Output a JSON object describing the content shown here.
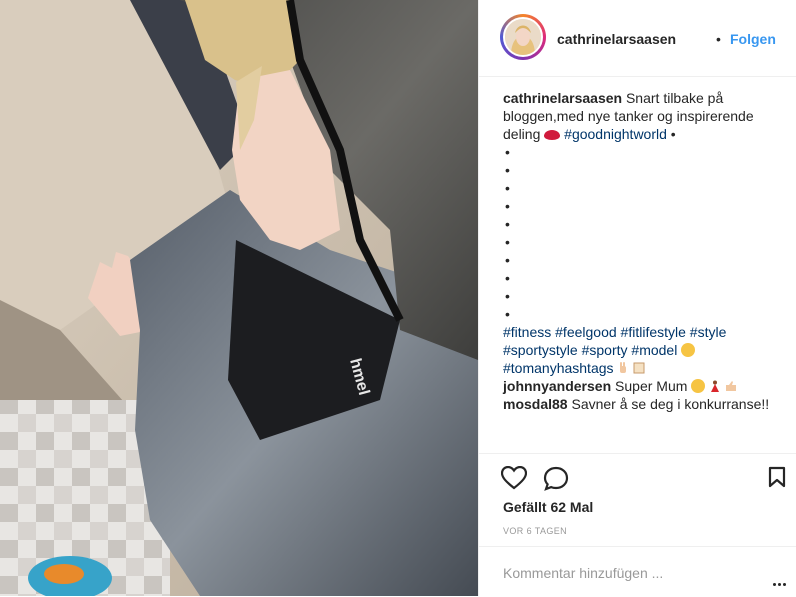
{
  "post": {
    "username": "cathrinelarsaasen",
    "follow_separator": "•",
    "follow_label": "Folgen"
  },
  "caption": {
    "username": "cathrinelarsaasen",
    "text": "Snart tilbake på bloggen,med nye tanker og inspirerende deling",
    "hashtag_main": "#goodnightworld",
    "bullet": "•",
    "bullet_count": 10,
    "hashtags": [
      "#fitness",
      "#feelgood",
      "#fitlifestyle",
      "#style",
      "#sportystyle",
      "#sporty",
      "#model",
      "#tomanyhashtags"
    ]
  },
  "comments": [
    {
      "username": "johnnyandersen",
      "text": "Super Mum"
    },
    {
      "username": "mosdal88",
      "text": "Savner å se deg i konkurranse!!"
    }
  ],
  "likes_text": "Gefällt 62 Mal",
  "timestamp": "VOR 6 TAGEN",
  "comment_placeholder": "Kommentar hinzufügen ...",
  "icons": {
    "like": "heart-icon",
    "comment": "comment-bubble-icon",
    "save": "bookmark-icon",
    "more": "more-options-icon"
  },
  "colors": {
    "follow": "#3897f0",
    "hashtag": "#003569",
    "muted": "#999999",
    "text": "#262626"
  }
}
